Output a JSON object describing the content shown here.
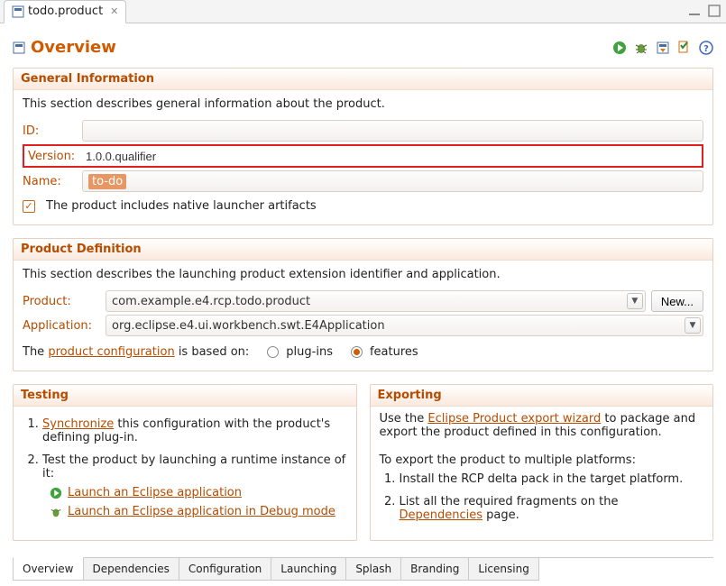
{
  "tab": {
    "title": "todo.product"
  },
  "overview_title": "Overview",
  "general": {
    "title": "General Information",
    "desc": "This section describes general information about the product.",
    "id_label": "ID:",
    "id_value": "",
    "version_label": "Version:",
    "version_value": "1.0.0.qualifier",
    "name_label": "Name:",
    "name_value": "to-do",
    "native_checkbox_label": "The product includes native launcher artifacts"
  },
  "definition": {
    "title": "Product Definition",
    "desc": "This section describes the launching product extension identifier and application.",
    "product_label": "Product:",
    "product_value": "com.example.e4.rcp.todo.product",
    "new_btn": "New...",
    "application_label": "Application:",
    "application_value": "org.eclipse.e4.ui.workbench.swt.E4Application",
    "based_on_pre": "The ",
    "based_on_link": "product configuration",
    "based_on_post": " is based on:",
    "plugins_label": "plug-ins",
    "features_label": "features"
  },
  "testing": {
    "title": "Testing",
    "step1_link": "Synchronize",
    "step1_post": " this configuration with the product's defining plug-in.",
    "step2": "Test the product by launching a runtime instance of it:",
    "launch_link": "Launch an Eclipse application",
    "debug_link": "Launch an Eclipse application in Debug mode"
  },
  "exporting": {
    "title": "Exporting",
    "line1_pre": "Use the ",
    "line1_link": "Eclipse Product export wizard",
    "line1_post": " to package and export the product defined in this configuration.",
    "line2": "To export the product to multiple platforms:",
    "step1": "Install the RCP delta pack in the target platform.",
    "step2_pre": "List all the required fragments on the ",
    "step2_link": "Dependencies",
    "step2_post": " page."
  },
  "bottom_tabs": [
    "Overview",
    "Dependencies",
    "Configuration",
    "Launching",
    "Splash",
    "Branding",
    "Licensing"
  ]
}
